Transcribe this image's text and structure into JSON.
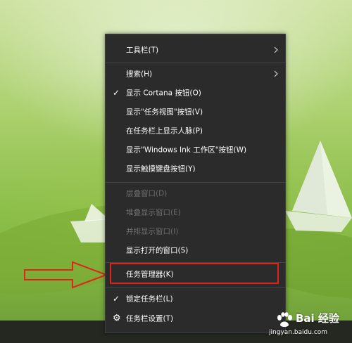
{
  "menu": {
    "items": [
      {
        "label": "工具栏(T)",
        "checked": false,
        "disabled": false,
        "submenu": true
      },
      {
        "label": "搜索(H)",
        "checked": false,
        "disabled": false,
        "submenu": true
      },
      {
        "label": "显示 Cortana 按钮(O)",
        "checked": true,
        "disabled": false,
        "submenu": false
      },
      {
        "label": "显示\"任务视图\"按钮(V)",
        "checked": false,
        "disabled": false,
        "submenu": false
      },
      {
        "label": "在任务栏上显示人脉(P)",
        "checked": false,
        "disabled": false,
        "submenu": false
      },
      {
        "label": "显示\"Windows Ink 工作区\"按钮(W)",
        "checked": false,
        "disabled": false,
        "submenu": false
      },
      {
        "label": "显示触摸键盘按钮(Y)",
        "checked": false,
        "disabled": false,
        "submenu": false
      },
      {
        "label": "层叠窗口(D)",
        "checked": false,
        "disabled": true,
        "submenu": false
      },
      {
        "label": "堆叠显示窗口(E)",
        "checked": false,
        "disabled": true,
        "submenu": false
      },
      {
        "label": "并排显示窗口(I)",
        "checked": false,
        "disabled": true,
        "submenu": false
      },
      {
        "label": "显示打开的窗口(S)",
        "checked": false,
        "disabled": false,
        "submenu": false
      },
      {
        "label": "任务管理器(K)",
        "checked": false,
        "disabled": false,
        "submenu": false
      },
      {
        "label": "锁定任务栏(L)",
        "checked": true,
        "disabled": false,
        "submenu": false
      },
      {
        "label": "任务栏设置(T)",
        "checked": false,
        "disabled": false,
        "submenu": false,
        "icon": "gear-icon"
      }
    ],
    "check_glyph": "✓",
    "settings_glyph": "⚙"
  },
  "watermark": {
    "brand": "Bai  经验",
    "url": "jingyan.baidu.com"
  },
  "colors": {
    "menu_bg": "#2b2b2b",
    "highlight": "#e2231a",
    "disabled_text": "#6d6d6d"
  }
}
